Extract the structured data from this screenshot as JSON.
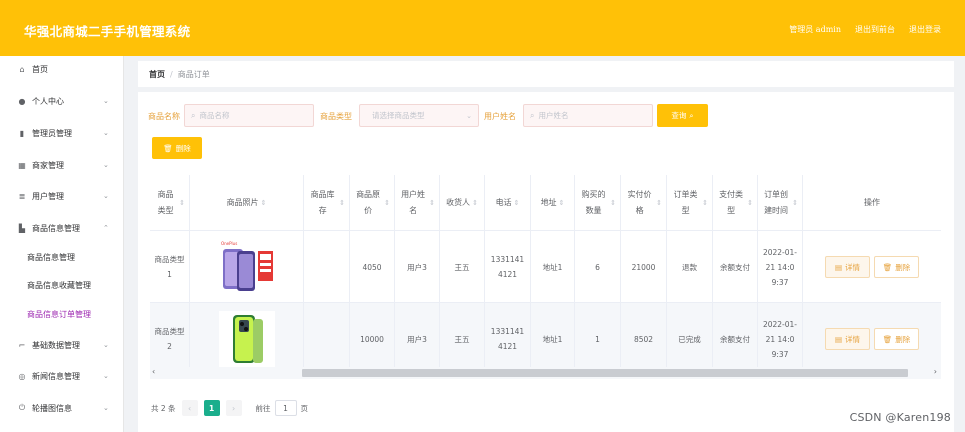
{
  "header": {
    "app_title": "华强北商城二手手机管理系统",
    "admin_label": "管理员 admin",
    "back_label": "退出到前台",
    "logout_label": "退出登录",
    "bg_color": "#ffc107"
  },
  "sidebar": {
    "items": [
      {
        "icon": "home-icon",
        "label": "首页",
        "has_arrow": false
      },
      {
        "icon": "user-icon",
        "label": "个人中心",
        "has_arrow": true
      },
      {
        "icon": "admin-icon",
        "label": "管理员管理",
        "has_arrow": true
      },
      {
        "icon": "grid-icon",
        "label": "商家管理",
        "has_arrow": true
      },
      {
        "icon": "list-icon",
        "label": "用户管理",
        "has_arrow": true
      },
      {
        "icon": "chart-icon",
        "label": "商品信息管理",
        "has_arrow": true,
        "expanded": true
      },
      {
        "label": "商品信息管理",
        "sub": true
      },
      {
        "label": "商品信息收藏管理",
        "sub": true
      },
      {
        "label": "商品信息订单管理",
        "sub": true,
        "active": true
      },
      {
        "icon": "crop-icon",
        "label": "基础数据管理",
        "has_arrow": true
      },
      {
        "icon": "globe-icon",
        "label": "新闻信息管理",
        "has_arrow": true
      },
      {
        "icon": "power-icon",
        "label": "轮播图信息",
        "has_arrow": true
      }
    ],
    "active_color": "#9c27b0"
  },
  "breadcrumb": {
    "home": "首页",
    "separator": "/",
    "current": "商品订单"
  },
  "filters": {
    "name_label": "商品名称",
    "name_placeholder": "商品名称",
    "type_label": "商品类型",
    "type_placeholder": "请选择商品类型",
    "user_label": "用户姓名",
    "user_placeholder": "用户姓名",
    "search_button": "查询",
    "delete_button": "删除"
  },
  "table": {
    "columns": [
      "商品类型",
      "商品照片",
      "商品库存",
      "商品原价",
      "用户姓名",
      "收货人",
      "电话",
      "地址",
      "购买的数量",
      "实付价格",
      "订单类型",
      "支付类型",
      "订单创建时间",
      "操作"
    ],
    "rows": [
      {
        "type": "商品类型1",
        "photo": "purple-phone",
        "stock": "",
        "price": "4050",
        "user": "用户3",
        "receiver": "王五",
        "phone": "13311414121",
        "address": "地址1",
        "qty": "6",
        "paid": "21000",
        "order_type": "退款",
        "pay_type": "余额支付",
        "created": "2022-01-21 14:09:37"
      },
      {
        "type": "商品类型2",
        "photo": "green-phone",
        "stock": "",
        "price": "10000",
        "user": "用户3",
        "receiver": "王五",
        "phone": "13311414121",
        "address": "地址1",
        "qty": "1",
        "paid": "8502",
        "order_type": "已完成",
        "pay_type": "余额支付",
        "created": "2022-01-21 14:09:37"
      }
    ],
    "detail_label": "详情",
    "delete_label": "删除"
  },
  "pagination": {
    "total_text": "共 2 条",
    "current_page": "1",
    "goto_label": "前往",
    "goto_value": "1",
    "page_suffix": "页"
  },
  "watermark": "CSDN @Karen198"
}
